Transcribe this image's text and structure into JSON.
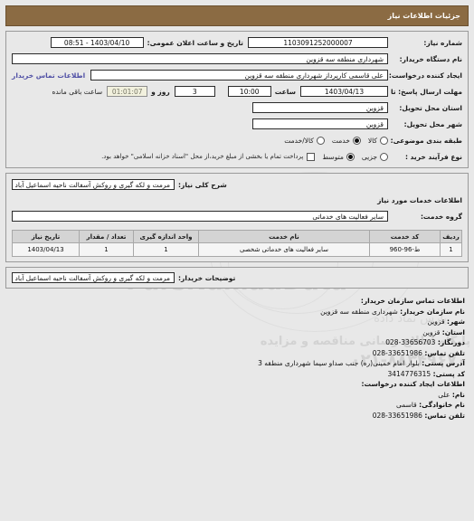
{
  "header": {
    "title": "جزئیات اطلاعات نیاز"
  },
  "need_info": {
    "need_number_label": "شماره نیاز:",
    "need_number_value": "1103091252000007",
    "announce_datetime_label": "تاریخ و ساعت اعلان عمومی:",
    "announce_datetime_value": "1403/04/10 - 08:51",
    "buyer_org_label": "نام دستگاه خریدار:",
    "buyer_org_value": "شهرداری منطقه سه قزوین",
    "creator_label": "ایجاد کننده درخواست:",
    "creator_value": "علی قاسمی کارپرداز شهرداری منطقه سه قزوین",
    "contact_link_label": "اطلاعات تماس خریدار",
    "deadline_label": "مهلت ارسال پاسخ: تا تاریخ:",
    "deadline_date_value": "1403/04/13",
    "deadline_hour_label": "ساعت",
    "deadline_hour_value": "10:00",
    "days_value": "3",
    "days_label": "روز و",
    "countdown_value": "01:01:07",
    "countdown_label": "ساعت باقی مانده",
    "province_label": "استان محل تحویل:",
    "province_value": "قزوین",
    "city_label": "شهر محل تحویل:",
    "city_value": "قزوین",
    "classification_label": "طبقه بندی موضوعی:",
    "classification_options": [
      {
        "label": "کالا",
        "selected": false
      },
      {
        "label": "خدمت",
        "selected": true
      },
      {
        "label": "کالا/خدمت",
        "selected": false
      }
    ],
    "process_label": "نوع فرآیند خرید :",
    "process_options": [
      {
        "label": "جزیی",
        "selected": false
      },
      {
        "label": "متوسط",
        "selected": true
      }
    ],
    "treasury_checkbox_checked": false,
    "treasury_checkbox_label": "پرداخت تمام یا بخشی از مبلغ خرید،از محل \"اسناد خزانه اسلامی\" خواهد بود."
  },
  "description": {
    "summary_label": "شرح کلی نیاز:",
    "summary_value": "مرمت و لکه گیری و روکش آسفالت ناحیه اسماعیل آباد",
    "services_section_title": "اطلاعات خدمات مورد نیاز",
    "service_group_label": "گروه خدمت:",
    "service_group_value": "سایر فعالیت های خدماتی"
  },
  "table": {
    "columns": [
      "ردیف",
      "کد خدمت",
      "نام خدمت",
      "واحد اندازه گیری",
      "تعداد / مقدار",
      "تاریخ نیاز"
    ],
    "rows": [
      [
        "1",
        "ط-96-960",
        "سایر فعالیت های خدماتی شخصی",
        "1",
        "1",
        "1403/04/13"
      ]
    ]
  },
  "buyer_notes": {
    "label": "توضیحات خریدار:",
    "value": "مرمت و لکه گیری و روکش آسفالت ناحیه اسماعیل آباد"
  },
  "contact": {
    "org_section_title": "اطلاعات تماس سازمان خریدار:",
    "org_name_key": "نام سازمان خریدار:",
    "org_name_value": "شهرداری منطقه سه قزوین",
    "city_key": "شهر:",
    "city_value": "قزوین",
    "province_key": "استان:",
    "province_value": "قزوین",
    "fax_key": "دورنگار:",
    "fax_value": "33656703-028",
    "phone_key": "تلفن تماس:",
    "phone_value": "33651986-028",
    "address_key": "آدرس پستی:",
    "address_value": "بلوار امام خمینی(ره) جنب صداو سیما شهرداری منطقه 3",
    "postal_code_key": "کد پستی:",
    "postal_code_value": "3414776315",
    "creator_section_title": "اطلاعات ایجاد کننده درخواست:",
    "first_name_key": "نام:",
    "first_name_value": "علی",
    "last_name_key": "نام خانوادگی:",
    "last_name_value": "قاسمی",
    "creator_phone_key": "تلفن تماس:",
    "creator_phone_value": "33651986-028"
  },
  "watermark": {
    "brand": "ParsNamadData",
    "line_top": "پایگاه اطلاع رسانی مناقصه و مزایده",
    "line_phone": "۰۲۱-۸۸۳۴۹۶۷۰",
    "line_script": "پارس نماد داده"
  },
  "colors": {
    "header_brown": "#8b6b43",
    "page_background": "#e8e8e8",
    "table_header_gray": "#d4d4d4",
    "link_purple": "#4f4fa5",
    "countdown_cream": "#f2f1de"
  }
}
